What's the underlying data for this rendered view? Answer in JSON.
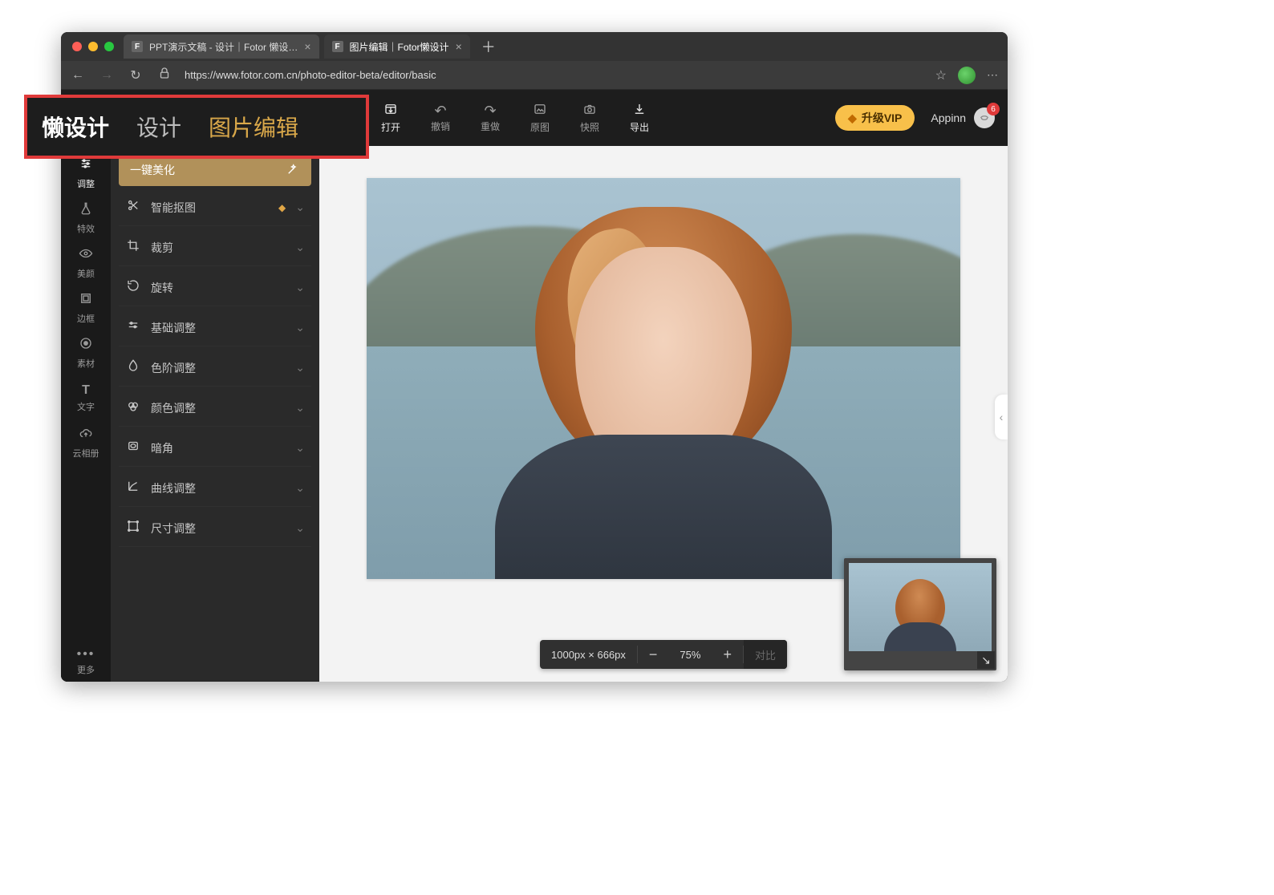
{
  "browser": {
    "tabs": [
      {
        "title": "PPT演示文稿 - 设计｜Fotor 懒设…",
        "favicon": "F"
      },
      {
        "title": "图片编辑｜Fotor懒设计",
        "favicon": "F"
      }
    ],
    "active_tab_index": 1,
    "url_display": "https://www.fotor.com.cn/photo-editor-beta/editor/basic"
  },
  "header": {
    "logo": "懒设计",
    "tabs": [
      {
        "label": "设计",
        "active": false
      },
      {
        "label": "图片编辑",
        "active": true
      }
    ],
    "actions": [
      {
        "id": "open",
        "label": "打开"
      },
      {
        "id": "undo",
        "label": "撤销"
      },
      {
        "id": "redo",
        "label": "重做"
      },
      {
        "id": "original",
        "label": "原图"
      },
      {
        "id": "snapshot",
        "label": "快照"
      },
      {
        "id": "export",
        "label": "导出"
      }
    ],
    "vip_button": "升级VIP",
    "user_name": "Appinn",
    "notification_count": "6"
  },
  "leftrail": {
    "items": [
      {
        "id": "adjust",
        "label": "调整",
        "active": true
      },
      {
        "id": "effects",
        "label": "特效"
      },
      {
        "id": "beauty",
        "label": "美颜"
      },
      {
        "id": "frame",
        "label": "边框"
      },
      {
        "id": "stickers",
        "label": "素材"
      },
      {
        "id": "text",
        "label": "文字"
      },
      {
        "id": "cloud",
        "label": "云相册"
      }
    ],
    "more_label": "更多"
  },
  "tools": {
    "enhance_button": "一键美化",
    "items": [
      {
        "id": "cutout",
        "label": "智能抠图",
        "vip": true
      },
      {
        "id": "crop",
        "label": "裁剪"
      },
      {
        "id": "rotate",
        "label": "旋转"
      },
      {
        "id": "basic",
        "label": "基础调整"
      },
      {
        "id": "levels",
        "label": "色阶调整"
      },
      {
        "id": "color",
        "label": "颜色调整"
      },
      {
        "id": "vignette",
        "label": "暗角"
      },
      {
        "id": "curves",
        "label": "曲线调整"
      },
      {
        "id": "resize",
        "label": "尺寸调整"
      }
    ]
  },
  "canvas": {
    "dimensions_label": "1000px × 666px",
    "zoom_label": "75%",
    "compare_label": "对比"
  }
}
